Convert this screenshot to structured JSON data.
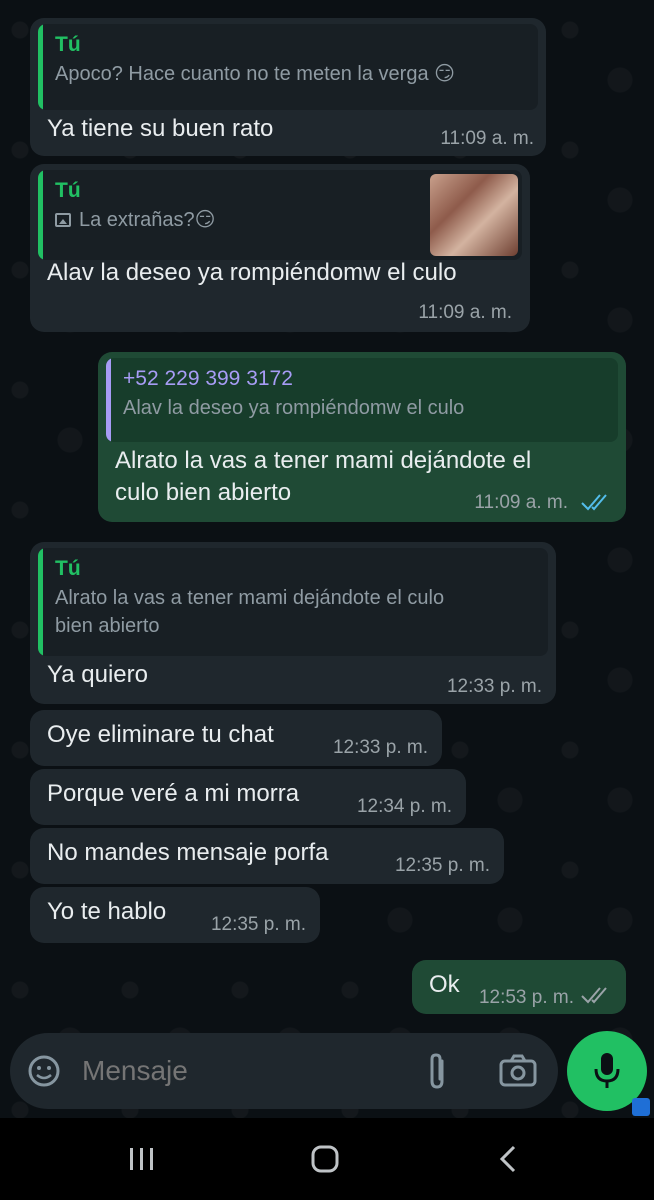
{
  "messages": [
    {
      "quote_author": "Tú",
      "quote_text": "Apoco? Hace cuanto no te meten la verga 😏",
      "text": "Ya tiene su buen rato",
      "time": "11:09 a. m."
    },
    {
      "quote_author": "Tú",
      "quote_text": "La extrañas?😏",
      "text": "Alav la deseo ya rompiéndomw el culo",
      "time": "11:09 a. m."
    },
    {
      "quote_author": "+52 229 399 3172",
      "quote_text": "Alav la deseo ya rompiéndomw el culo",
      "text_line1": "Alrato la vas a tener mami dejándote el",
      "text_line2": "culo bien abierto",
      "time": "11:09 a. m."
    },
    {
      "quote_author": "Tú",
      "quote_text_line1": "Alrato la vas a tener mami dejándote el culo",
      "quote_text_line2": "bien abierto",
      "text": "Ya quiero",
      "time": "12:33 p. m."
    },
    {
      "text": "Oye eliminare tu chat",
      "time": "12:33 p. m."
    },
    {
      "text": "Porque veré a mi morra",
      "time": "12:34 p. m."
    },
    {
      "text": "No mandes mensaje porfa",
      "time": "12:35 p. m."
    },
    {
      "text": "Yo te hablo",
      "time": "12:35 p. m."
    },
    {
      "text": "Ok",
      "time": "12:53 p. m."
    }
  ],
  "input": {
    "placeholder": "Mensaje"
  },
  "colors": {
    "accent": "#21c063",
    "incoming": "#1f272d",
    "outgoing": "#1f4a35",
    "read_ticks": "#53bdeb"
  }
}
